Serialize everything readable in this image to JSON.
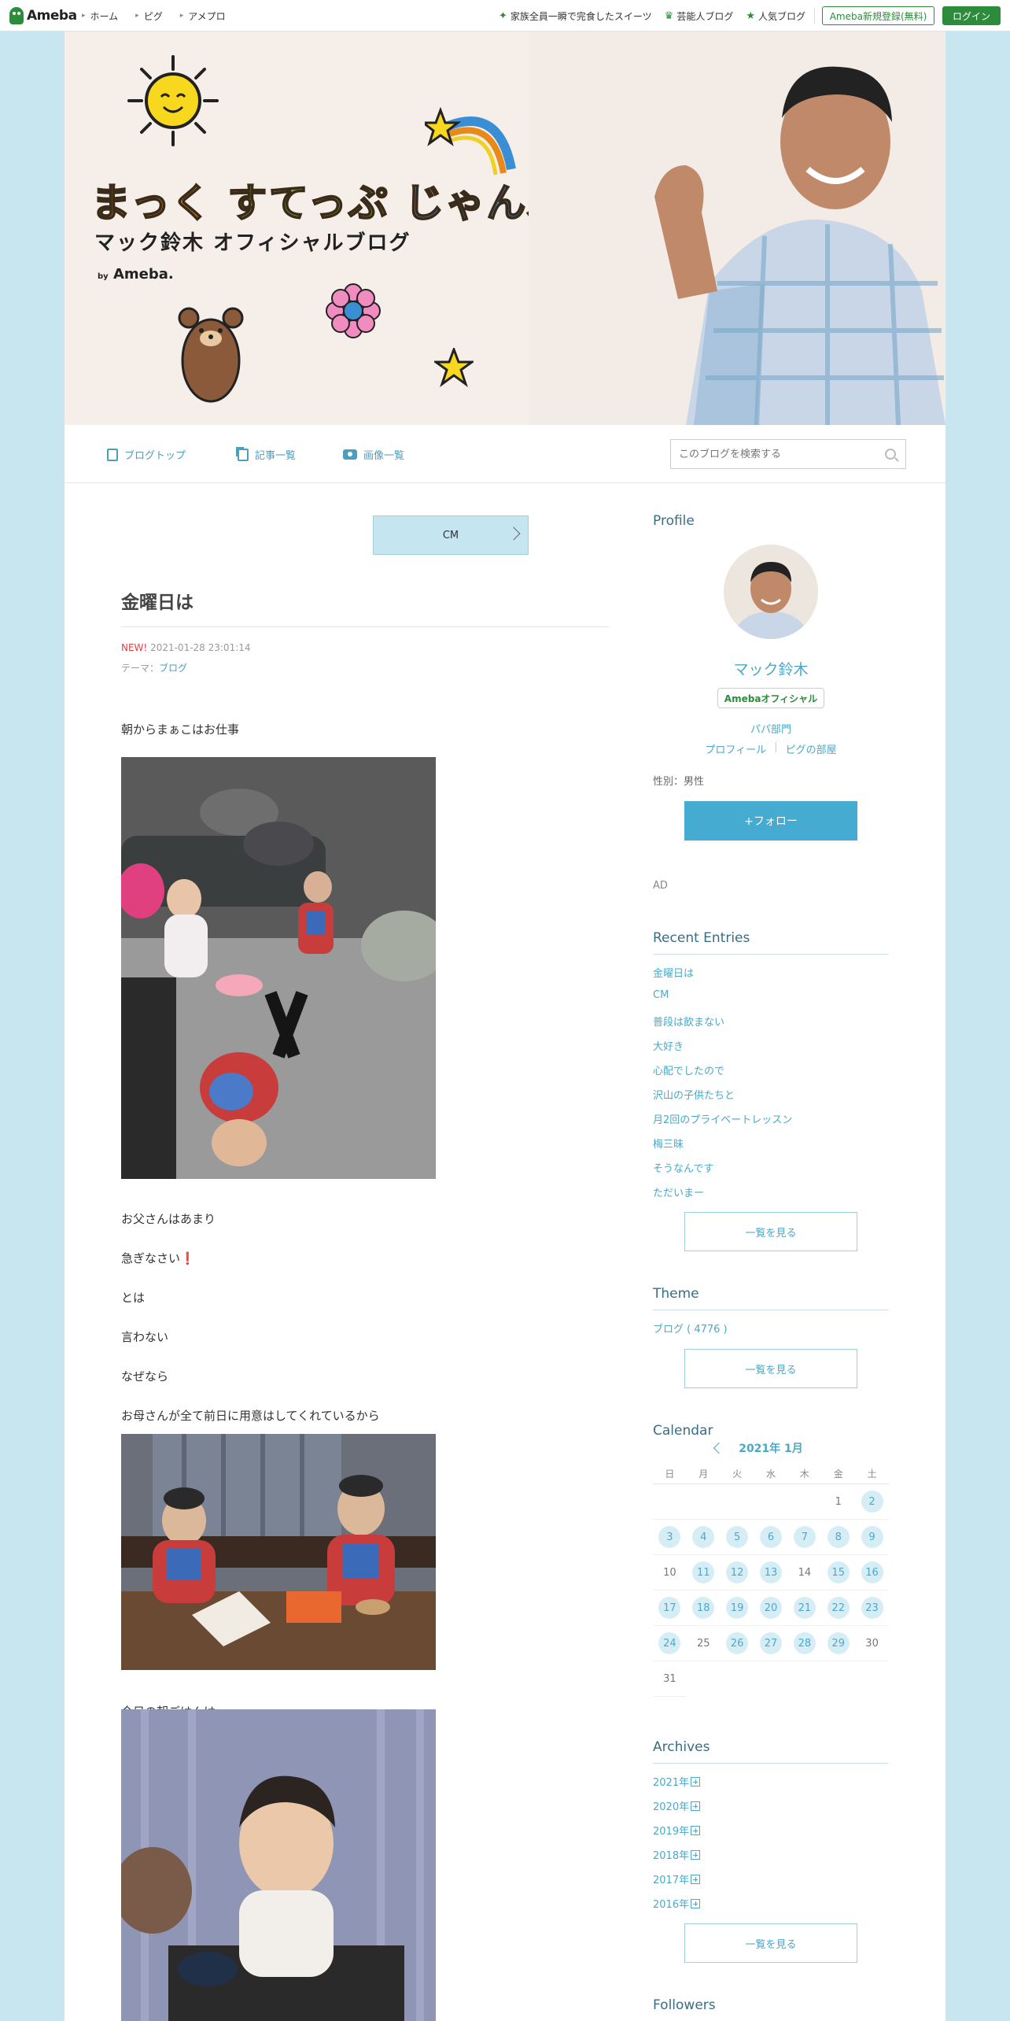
{
  "global_nav": {
    "logo_text": "Ameba",
    "items": [
      {
        "label": "ホーム"
      },
      {
        "label": "ピグ"
      },
      {
        "label": "アメプロ"
      }
    ],
    "trending": [
      {
        "label": "家族全員一瞬で完食したスイーツ",
        "icon": "sparkle-icon"
      },
      {
        "label": "芸能人ブログ",
        "icon": "crown-icon"
      },
      {
        "label": "人気ブログ",
        "icon": "star-icon"
      }
    ],
    "register_label": "Ameba新規登録(無料)",
    "login_label": "ログイン"
  },
  "banner": {
    "title_part1": "まっく",
    "title_part2": "すてっぷ",
    "title_part3": "じゃんぷ",
    "subtitle": "マック鈴木 オフィシャルブログ",
    "by_prefix": "by",
    "by_brand": "Ameba."
  },
  "blog_nav": {
    "items": [
      {
        "label": "ブログトップ",
        "icon": "document-icon"
      },
      {
        "label": "記事一覧",
        "icon": "copy-icon"
      },
      {
        "label": "画像一覧",
        "icon": "camera-icon"
      }
    ],
    "search_placeholder": "このブログを検索する"
  },
  "article": {
    "prev_link": "CM",
    "title": "金曜日は",
    "new_badge": "NEW!",
    "datetime": "2021-01-28 23:01:14",
    "theme_prefix": "テーマ：",
    "theme": "ブログ",
    "lines": {
      "l1": "朝からまぁこはお仕事",
      "l2": "お父さんはあまり",
      "l3": "急ぎなさい",
      "l4": "とは",
      "l5": "言わない",
      "l6": "なぜなら",
      "l7": "お母さんが全て前日に用意はしてくれているから",
      "l8": "今日の朝ごはんは"
    },
    "exclamation": "❗"
  },
  "sidebar": {
    "profile": {
      "heading": "Profile",
      "name": "マック鈴木",
      "badge": "Amebaオフィシャル",
      "category": "パパ部門",
      "link_profile": "プロフィール",
      "link_pigg": "ピグの部屋",
      "gender": "性別：男性",
      "follow_label": "+フォロー"
    },
    "ad_label": "AD",
    "recent": {
      "heading": "Recent Entries",
      "items": [
        "金曜日は",
        "CM",
        "普段は飲まない",
        "大好き",
        "心配でしたので",
        "沢山の子供たちと",
        "月2回のプライベートレッスン",
        "梅三昧",
        "そうなんです",
        "ただいまー"
      ],
      "more": "一覧を見る"
    },
    "theme": {
      "heading": "Theme",
      "item": "ブログ ( 4776 )",
      "more": "一覧を見る"
    },
    "calendar": {
      "heading": "Calendar",
      "month": "2021年 1月",
      "dow": [
        "日",
        "月",
        "火",
        "水",
        "木",
        "金",
        "土"
      ],
      "days_with_posts": [
        2,
        3,
        4,
        5,
        6,
        7,
        8,
        9,
        11,
        12,
        13,
        15,
        16,
        17,
        18,
        19,
        20,
        21,
        22,
        23,
        24,
        26,
        27,
        28,
        29
      ]
    },
    "archives": {
      "heading": "Archives",
      "items": [
        "2021年",
        "2020年",
        "2019年",
        "2018年",
        "2017年",
        "2016年"
      ],
      "more": "一覧を見る"
    },
    "followers_heading": "Followers"
  }
}
